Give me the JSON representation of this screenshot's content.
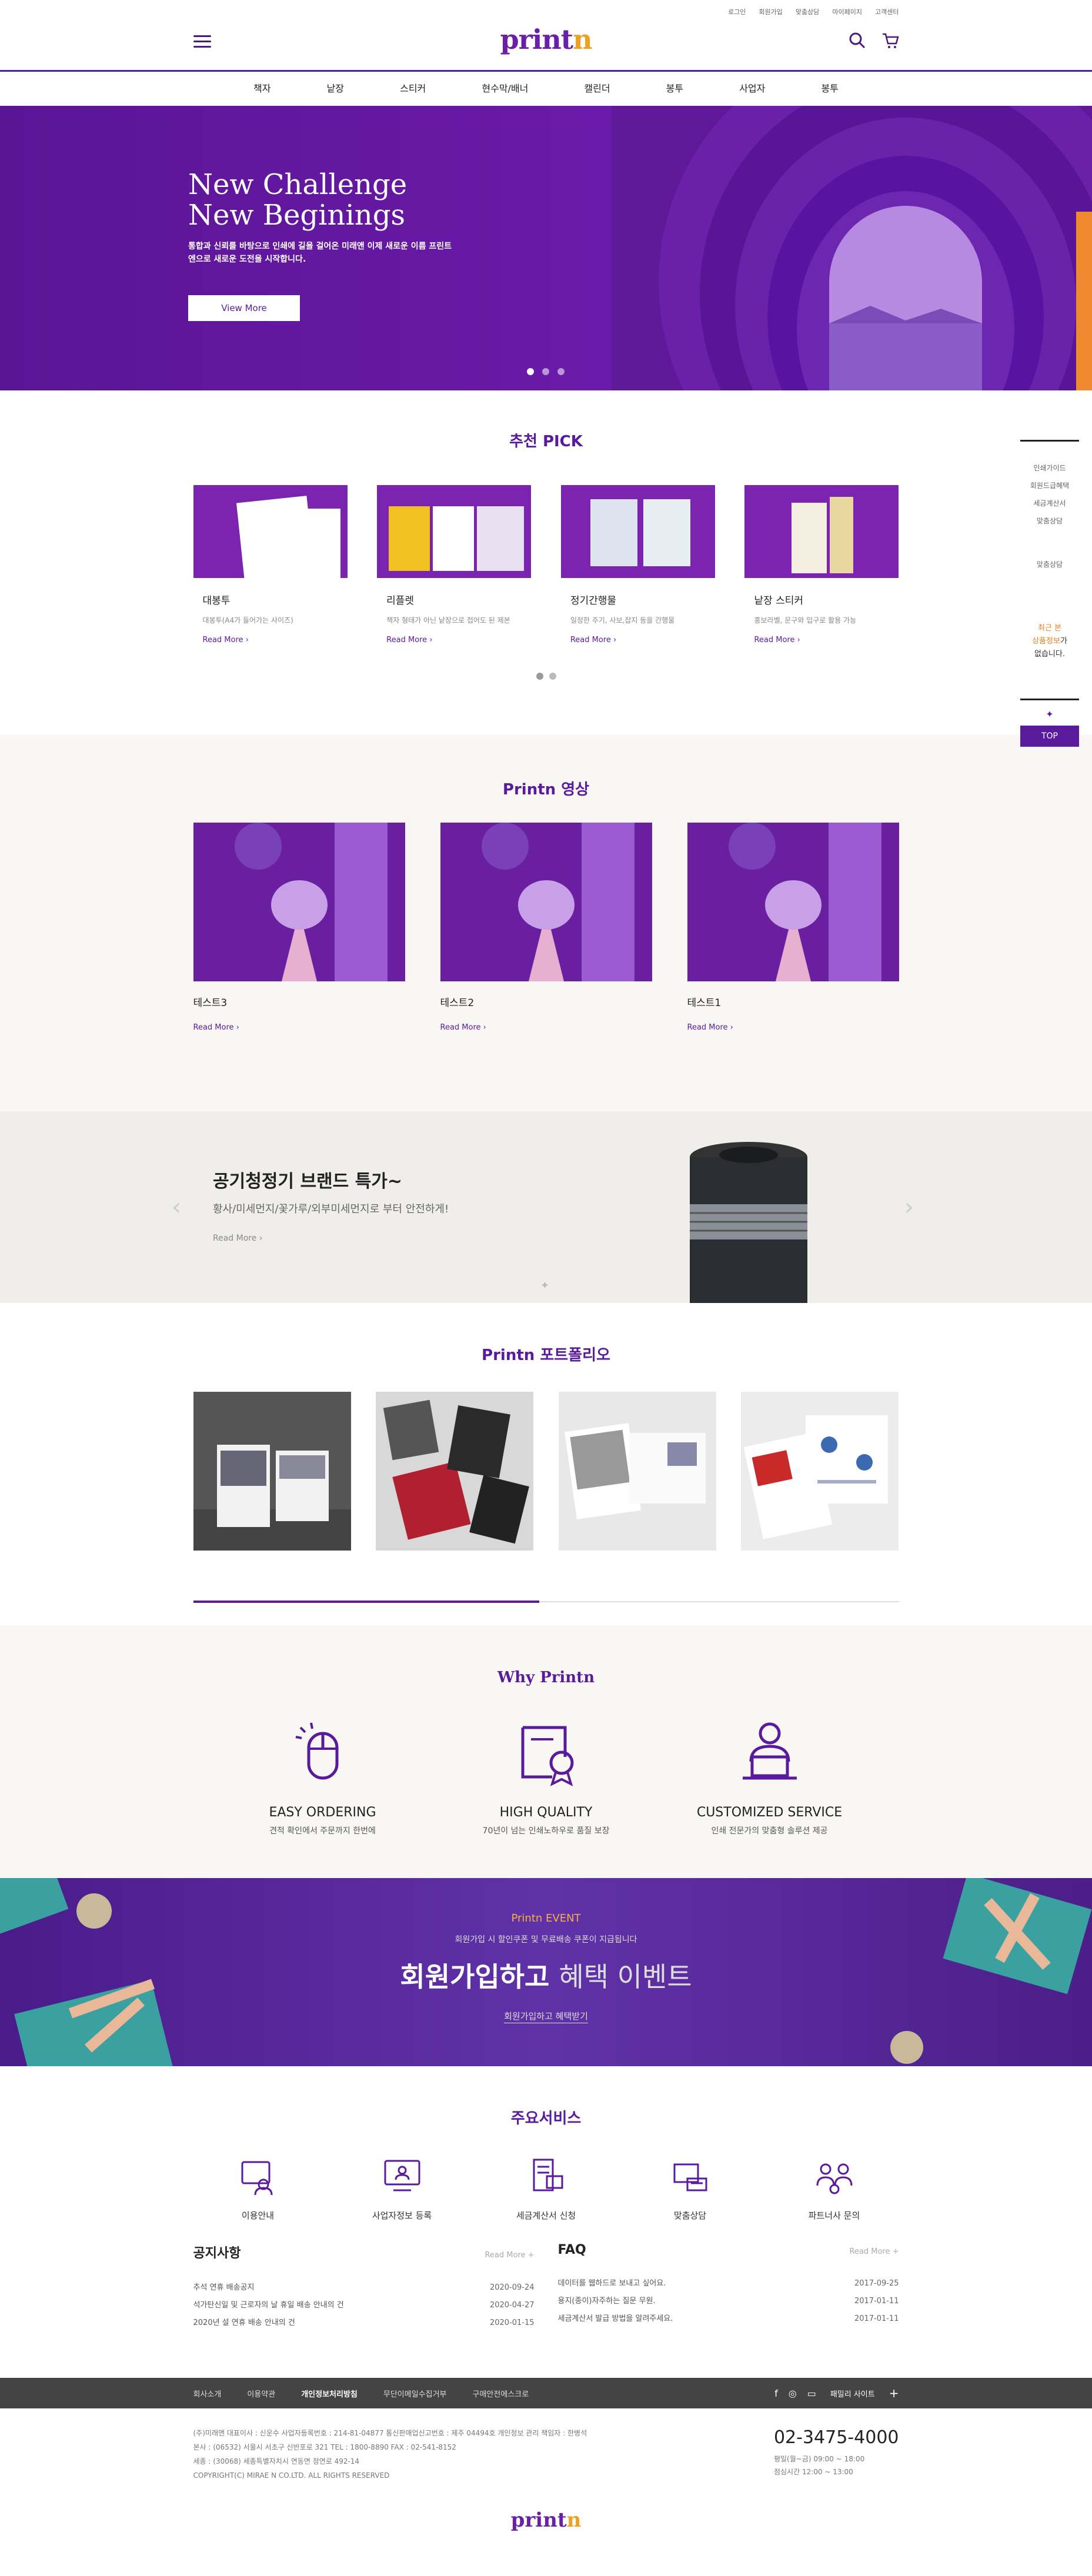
{
  "topbar": {
    "links": [
      "로그인",
      "회원가입",
      "맞춤상담",
      "마이페이지",
      "고객센터"
    ]
  },
  "logo": {
    "main": "print",
    "accent": "n"
  },
  "gnb": [
    "책자",
    "낱장",
    "스티커",
    "현수막/배너",
    "캘린더",
    "봉투",
    "사업자",
    "봉투"
  ],
  "hero": {
    "title_1": "New Challenge",
    "title_2": "New Beginings",
    "desc": "통합과 신뢰를 바탕으로 인쇄에 길을 걸어온 미래앤 이제 새로운 이름 프린트엔으로 새로운 도전을 시작합니다.",
    "button": "View More"
  },
  "pick": {
    "title": "추천 PICK",
    "cards": [
      {
        "title": "대봉투",
        "desc": "대봉투(A4가 들어가는 사이즈)",
        "more": "Read More"
      },
      {
        "title": "리플렛",
        "desc": "책자 형태가 아닌 낱장으로 접어도 된 제본",
        "more": "Read More"
      },
      {
        "title": "정기간행물",
        "desc": "일정한 주기, 사보,잡지 등을 간행물",
        "more": "Read More"
      },
      {
        "title": "낱장 스티커",
        "desc": "홍보라벨, 문구와 입구로 활용 가능",
        "more": "Read More"
      }
    ]
  },
  "video": {
    "title": "Printn 영상",
    "cards": [
      {
        "title": "테스트3",
        "more": "Read More"
      },
      {
        "title": "테스트2",
        "more": "Read More"
      },
      {
        "title": "테스트1",
        "more": "Read More"
      }
    ]
  },
  "promo": {
    "title": "공기청정기 브랜드 특가~",
    "sub": "황사/미세먼지/꽃가루/외부미세먼지로 부터 안전하게!",
    "more": "Read More"
  },
  "portfolio": {
    "title": "Printn 포트폴리오"
  },
  "why": {
    "title": "Why Printn",
    "items": [
      {
        "title": "EASY ORDERING",
        "desc": "견적 확인에서 주문까지 한번에"
      },
      {
        "title": "HIGH QUALITY",
        "desc": "70년이 넘는 인쇄노하우로 품질 보장"
      },
      {
        "title": "CUSTOMIZED SERVICE",
        "desc": "인쇄 전문가의 맞춤형 솔루션 제공"
      }
    ]
  },
  "event": {
    "label": "Printn EVENT",
    "small": "회원가입 시 할인쿠폰 및 무료배송 쿠폰이 지급됩니다",
    "title_bold": "회원가입하고",
    "title_light": "혜택 이벤트",
    "link": "회원가입하고 혜택받기"
  },
  "services": {
    "title": "주요서비스",
    "items": [
      "이용안내",
      "사업자정보 등록",
      "세금계산서 신청",
      "맞춤상담",
      "파트너사 문의"
    ]
  },
  "notice": {
    "title": "공지사항",
    "more": "Read More",
    "items": [
      {
        "text": "추석 연휴 배송공지",
        "date": "2020-09-24"
      },
      {
        "text": "석가탄신일 및 근로자의 날 휴일 배송 안내의 건",
        "date": "2020-04-27"
      },
      {
        "text": "2020년 설 연휴 배송 안내의 건",
        "date": "2020-01-15"
      }
    ]
  },
  "faq": {
    "title": "FAQ",
    "more": "Read More",
    "items": [
      {
        "text": "데이터를 웹하드로 보내고 싶어요.",
        "date": "2017-09-25"
      },
      {
        "text": "용지(종이)자주하는 질문 무원.",
        "date": "2017-01-11"
      },
      {
        "text": "세금계산서 발급 방법을 알려주세요.",
        "date": "2017-01-11"
      }
    ]
  },
  "footer_nav": {
    "links": [
      "회사소개",
      "이용약관",
      "개인정보처리방침",
      "무단이메일수집거부",
      "구매안전에스크로"
    ],
    "family": "패밀리 사이트"
  },
  "footer": {
    "line1": "(주)미래앤 대표이사 : 신운수 사업자등록번호 : 214-81-04877 통신판매업신고번호 : 제주 04494호 개인정보 관리 책임자 : 한병석",
    "line2": "본사 : (06532) 서울시 서초구 신반포로 321 TEL : 1800-8890 FAX : 02-541-8152",
    "line3": "세종 : (30068) 세종특별자치시 연동면 정연로 492-14",
    "copyright": "COPYRIGHT(C) MIRAE N CO.LTD. ALL RIGHTS RESERVED",
    "tel": "02-3475-4000",
    "hours1": "평일(월~금) 09:00 ~ 18:00",
    "hours2": "점심시간 12:00 ~ 13:00"
  },
  "quick": {
    "items": [
      "인쇄가이드",
      "회원드급혜택",
      "세금계산서",
      "맞춤상담"
    ],
    "consult": "맞춤상담",
    "recent_1": "최근 본",
    "recent_2": "상품정보",
    "recent_3": "가",
    "recent_4": "없습니다.",
    "top": "TOP"
  }
}
